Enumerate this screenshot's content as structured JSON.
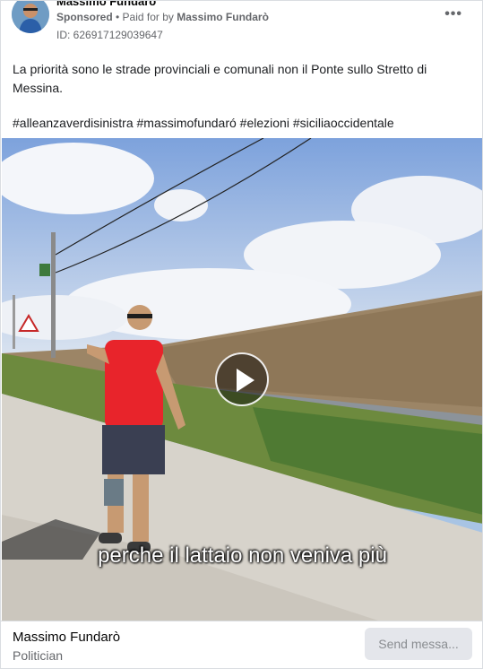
{
  "header": {
    "page_name": "Massimo Fundaró",
    "sponsored_label": "Sponsored",
    "paid_for_prefix": " • Paid for by ",
    "paid_for_name": "Massimo Fundarò",
    "ad_id": "ID: 626917129039647",
    "more_icon": "more-horizontal-icon"
  },
  "post": {
    "text": "La priorità sono le strade provinciali e comunali non il Ponte sullo Stretto di Messina.",
    "hashtags": "#alleanzaverdisinistra #massimofundaró #elezioni #siciliaoccidentale"
  },
  "video": {
    "subtitle": "perche il lattaio non veniva più",
    "play_icon": "play-icon"
  },
  "footer": {
    "name": "Massimo Fundarò",
    "category": "Politician",
    "send_button": "Send messa..."
  },
  "colors": {
    "muted_text": "#65676b",
    "button_bg": "#e4e6eb",
    "border": "#dadde1"
  }
}
